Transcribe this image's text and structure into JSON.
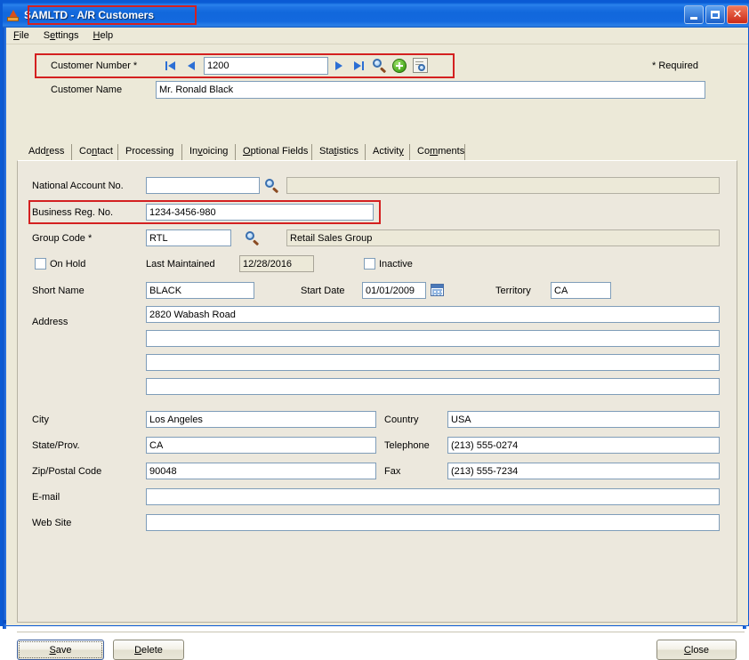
{
  "window": {
    "title": "SAMLTD - A/R Customers",
    "icon": "app-icon",
    "buttons": {
      "minimize": "minimize",
      "maximize": "maximize",
      "close": "close"
    }
  },
  "menubar": {
    "items": [
      {
        "label": "File",
        "accel": "F"
      },
      {
        "label": "Settings",
        "accel": "e"
      },
      {
        "label": "Help",
        "accel": "H"
      }
    ]
  },
  "header": {
    "customer_number_label": "Customer Number *",
    "customer_number_value": "1200",
    "customer_name_label": "Customer Name",
    "customer_name_value": "Mr. Ronald Black",
    "required_legend": "* Required",
    "nav": {
      "first": "first-record",
      "previous": "previous-record",
      "next": "next-record",
      "last": "last-record",
      "find": "find-record",
      "new": "new-record",
      "drilldown": "drilldown"
    }
  },
  "tabs": [
    {
      "label": "Address",
      "accel": "r",
      "active": true
    },
    {
      "label": "Contact",
      "accel": "n",
      "active": false
    },
    {
      "label": "Processing",
      "accel": "",
      "active": false
    },
    {
      "label": "Invoicing",
      "accel": "v",
      "active": false
    },
    {
      "label": "Optional Fields",
      "accel": "O",
      "active": false
    },
    {
      "label": "Statistics",
      "accel": "t",
      "active": false
    },
    {
      "label": "Activity",
      "accel": "y",
      "active": false
    },
    {
      "label": "Comments",
      "accel": "m",
      "active": false
    }
  ],
  "address_tab": {
    "national_account_label": "National Account No.",
    "national_account_value": "",
    "national_account_desc": "",
    "business_reg_label": "Business Reg. No.",
    "business_reg_value": "1234-3456-980",
    "group_code_label": "Group Code *",
    "group_code_value": "RTL",
    "group_code_desc": "Retail Sales Group",
    "on_hold_label": "On Hold",
    "on_hold_checked": false,
    "last_maintained_label": "Last Maintained",
    "last_maintained_value": "12/28/2016",
    "inactive_label": "Inactive",
    "inactive_checked": false,
    "short_name_label": "Short Name",
    "short_name_value": "BLACK",
    "start_date_label": "Start Date",
    "start_date_value": "01/01/2009",
    "territory_label": "Territory",
    "territory_value": "CA",
    "address_label": "Address",
    "address_line1": "2820 Wabash Road",
    "address_line2": "",
    "address_line3": "",
    "address_line4": "",
    "city_label": "City",
    "city_value": "Los Angeles",
    "state_label": "State/Prov.",
    "state_value": "CA",
    "zip_label": "Zip/Postal Code",
    "zip_value": "90048",
    "country_label": "Country",
    "country_value": "USA",
    "telephone_label": "Telephone",
    "telephone_value": "(213) 555-0274",
    "fax_label": "Fax",
    "fax_value": "(213) 555-7234",
    "email_label": "E-mail",
    "email_value": "",
    "website_label": "Web Site",
    "website_value": ""
  },
  "footer": {
    "save_label": "Save",
    "save_accel": "S",
    "delete_label": "Delete",
    "delete_accel": "D",
    "close_label": "Close",
    "close_accel": "C"
  },
  "colors": {
    "titlebar_blue": "#1168dc",
    "panel_beige": "#ece8dd",
    "client_grey": "#ece9d8",
    "annotation_red": "#d42020",
    "field_border": "#7f9db9"
  }
}
